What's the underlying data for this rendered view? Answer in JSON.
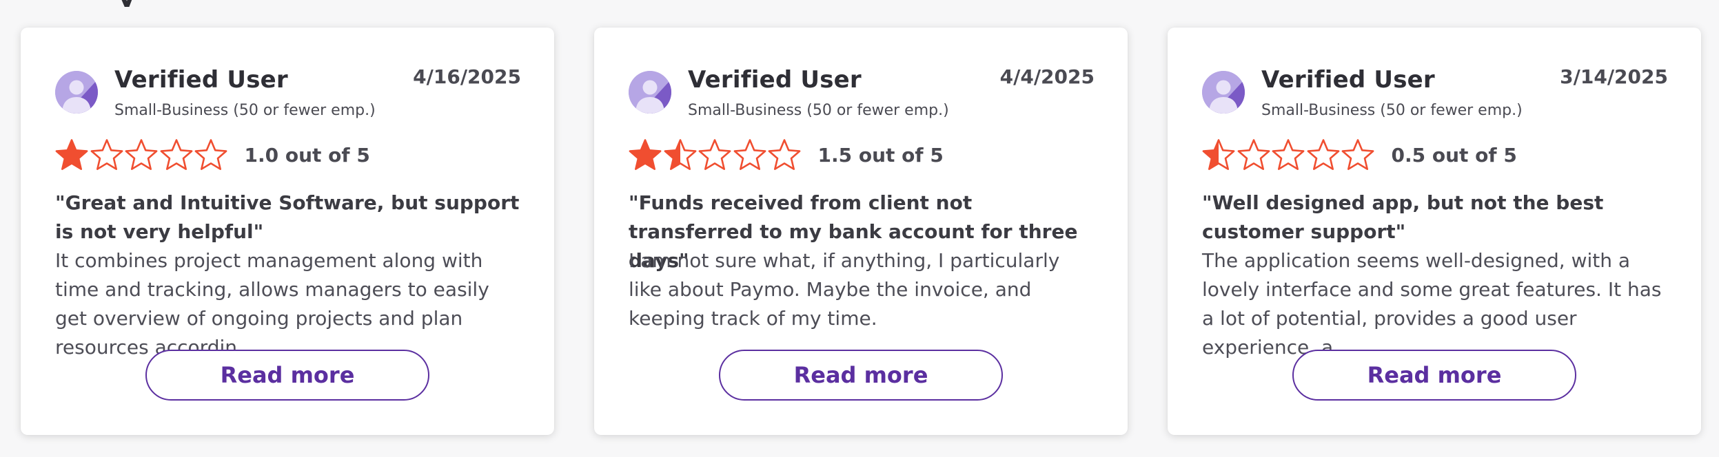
{
  "colors": {
    "star_fill": "#f04e30",
    "star_outline": "#f04e30",
    "button_accent": "#5b2fa0",
    "avatar_bg": "#b6a6e5",
    "avatar_figure": "#e8e2f8"
  },
  "reviews": [
    {
      "user_name": "Verified User",
      "user_meta": "Small-Business (50 or fewer emp.)",
      "date": "4/16/2025",
      "rating_value": 1.0,
      "rating_text": "1.0 out of 5",
      "title": "\"Great and Intuitive Software, but support is not very helpful\"",
      "body": "It combines project management along with time and tracking, allows managers to easily get overview of ongoing projects and plan resources accordin...",
      "button_label": "Read more"
    },
    {
      "user_name": "Verified User",
      "user_meta": "Small-Business (50 or fewer emp.)",
      "date": "4/4/2025",
      "rating_value": 1.5,
      "rating_text": "1.5 out of 5",
      "title": "\"Funds received from client not transferred to my bank account for three days\"",
      "body": "I am not sure what, if anything, I particularly like about Paymo. Maybe the invoice, and keeping track of my time.",
      "button_label": "Read more"
    },
    {
      "user_name": "Verified User",
      "user_meta": "Small-Business (50 or fewer emp.)",
      "date": "3/14/2025",
      "rating_value": 0.5,
      "rating_text": "0.5 out of 5",
      "title": "\"Well designed app, but not the best customer support\"",
      "body": "The application seems well-designed, with a lovely interface and some great features. It has a lot of potential, provides a good user experience, a...",
      "button_label": "Read more"
    }
  ]
}
